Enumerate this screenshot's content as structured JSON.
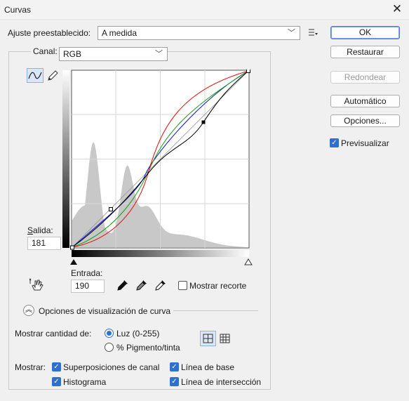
{
  "window": {
    "title": "Curvas"
  },
  "preset": {
    "label": "Ajuste preestablecido:",
    "value": "A medida"
  },
  "channel": {
    "label": "Canal:",
    "value": "RGB"
  },
  "buttons": {
    "ok": "OK",
    "reset": "Restaurar",
    "smooth": "Redondear",
    "auto": "Automático",
    "options": "Opciones...",
    "preview": "Previsualizar"
  },
  "output": {
    "label": "Salida:",
    "value": "181"
  },
  "input": {
    "label": "Entrada:",
    "value": "190"
  },
  "show_clipping": "Mostrar recorte",
  "display_options": {
    "label": "Opciones de visualización de curva"
  },
  "show_amount": {
    "label": "Mostrar cantidad de:",
    "light": "Luz (0-255)",
    "pigment": "% Pigmento/tinta",
    "selected": "light"
  },
  "show": {
    "label": "Mostrar:",
    "channel_overlays": "Superposiciones de canal",
    "histogram": "Histograma",
    "baseline": "Línea de base",
    "intersection": "Línea de intersección"
  },
  "icons": {
    "close": "close-icon",
    "preset_menu": "preset-menu-icon",
    "curve_tool": "curve-tool-icon",
    "pencil_tool": "pencil-tool-icon",
    "hand_tool": "on-image-adjust-icon",
    "eyedropper_black": "eyedropper-black-icon",
    "eyedropper_gray": "eyedropper-gray-icon",
    "eyedropper_white": "eyedropper-white-icon",
    "grid_simple": "grid-4x4-icon",
    "grid_detailed": "grid-10x10-icon",
    "collapse": "collapse-icon"
  },
  "colors": {
    "accent": "#2f6fd0",
    "curve_rgb": "#000000",
    "curve_red": "#e01010",
    "curve_green": "#10a010",
    "curve_blue": "#1010e0",
    "histogram": "#c8c8c8"
  }
}
